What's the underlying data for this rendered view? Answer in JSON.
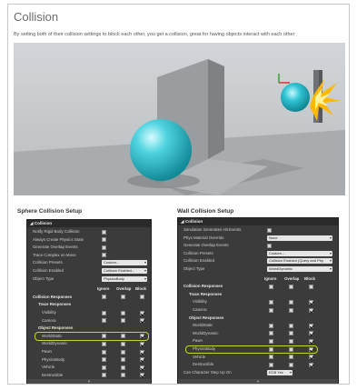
{
  "title": "Collision",
  "caption": "By setting both of their collision settings to block each other, you get a collision, great for having objects interact with each other",
  "sphere": {
    "title": "Sphere Collision Setup",
    "header": "Collision",
    "props": [
      {
        "label": "Notify Rigid Body Collision",
        "kind": "cb",
        "on": false
      },
      {
        "label": "Always Create Physics State",
        "kind": "cb",
        "on": false
      },
      {
        "label": "Generate Overlap Events",
        "kind": "cb",
        "on": false
      },
      {
        "label": "Trace Complex on Move",
        "kind": "cb",
        "on": false
      },
      {
        "label": "Collision Presets",
        "kind": "dd",
        "value": "Custom..."
      },
      {
        "label": "Collision Enabled",
        "kind": "dd",
        "value": "Collision Enabled..."
      },
      {
        "label": "Object Type",
        "kind": "dd",
        "value": "PhysicsBody"
      }
    ],
    "col_headers": [
      "Ignore",
      "Overlap",
      "Block"
    ],
    "responses_label": "Collision Responses",
    "trace_label": "Trace Responses",
    "trace": [
      {
        "label": "Visibility",
        "sel": 2
      },
      {
        "label": "Camera",
        "sel": 2
      }
    ],
    "object_label": "Object Responses",
    "objects": [
      {
        "label": "WorldStatic",
        "sel": 2
      },
      {
        "label": "WorldDynamic",
        "sel": 2
      },
      {
        "label": "Pawn",
        "sel": 2
      },
      {
        "label": "PhysicsBody",
        "sel": 2
      },
      {
        "label": "Vehicle",
        "sel": 2
      },
      {
        "label": "Destructible",
        "sel": 2
      }
    ]
  },
  "wall": {
    "title": "Wall Collision Setup",
    "header": "Collision",
    "props": [
      {
        "label": "Simulation Generates Hit Events",
        "kind": "cb",
        "on": false
      },
      {
        "label": "Phys Material Override",
        "kind": "dd",
        "value": "None"
      },
      {
        "label": "Generate Overlap Events",
        "kind": "cb",
        "on": false
      },
      {
        "label": "Collision Presets",
        "kind": "dd",
        "value": "Custom..."
      },
      {
        "label": "Collision Enabled",
        "kind": "dd",
        "value": "Collision Enabled (Query and Phy"
      },
      {
        "label": "Object Type",
        "kind": "dd",
        "value": "WorldDynamic"
      }
    ],
    "col_headers": [
      "Ignore",
      "Overlap",
      "Block"
    ],
    "responses_label": "Collision Responses",
    "trace_label": "Trace Responses",
    "trace": [
      {
        "label": "Visibility",
        "sel": 2
      },
      {
        "label": "Camera",
        "sel": 2
      }
    ],
    "object_label": "Object Responses",
    "objects": [
      {
        "label": "WorldStatic",
        "sel": 2
      },
      {
        "label": "WorldDynamic",
        "sel": 2
      },
      {
        "label": "Pawn",
        "sel": 2
      },
      {
        "label": "PhysicsBody",
        "sel": 2
      },
      {
        "label": "Vehicle",
        "sel": 2
      },
      {
        "label": "Destructible",
        "sel": 2
      }
    ],
    "step_label": "Can Character Step Up On",
    "step_value": "ECB Yes"
  },
  "colors": {
    "panel": "#3b3b3b",
    "highlight": "#c8d630",
    "sphere": "#35c6d4"
  }
}
